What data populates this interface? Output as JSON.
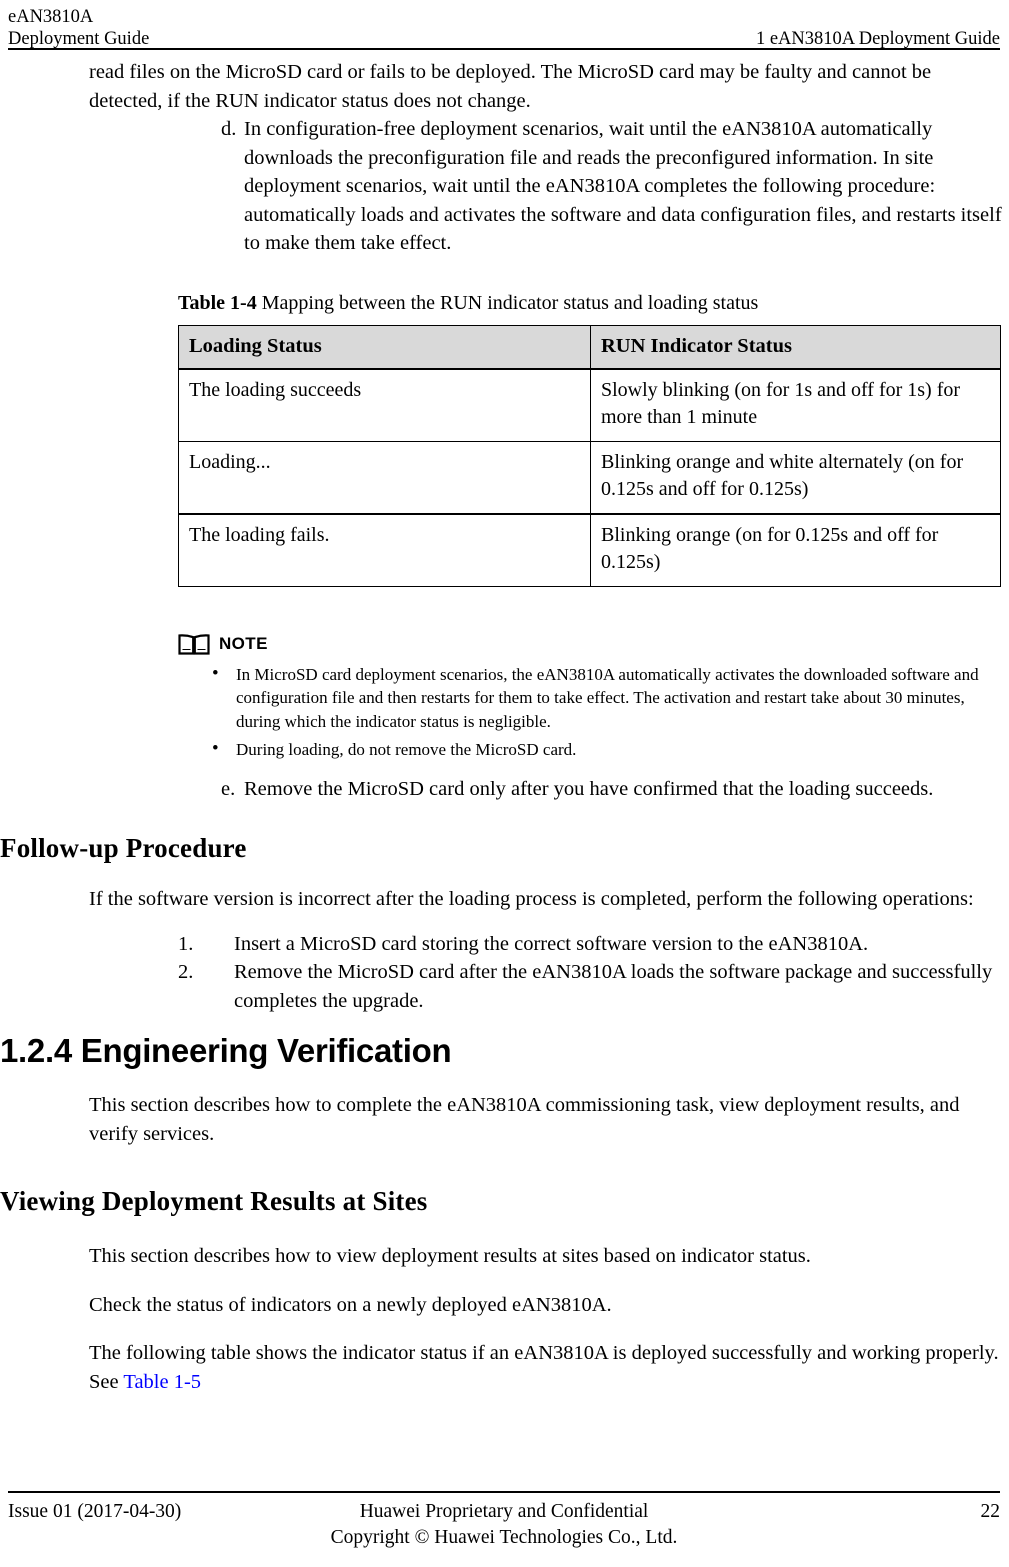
{
  "header": {
    "left_line1": "eAN3810A",
    "left_line2": "Deployment Guide",
    "right": "1 eAN3810A Deployment Guide"
  },
  "body": {
    "cont_paragraph": "read files on the MicroSD card or fails to be deployed. The MicroSD card may be faulty and cannot be detected, if the RUN indicator status does not change.",
    "item_d_marker": "d.",
    "item_d_text": "In configuration-free deployment scenarios, wait until the eAN3810A automatically downloads the preconfiguration file and reads the preconfigured information. In site deployment scenarios, wait until the eAN3810A completes the following procedure: automatically loads and activates the software and data configuration files, and restarts itself to make them take effect.",
    "item_e_marker": "e.",
    "item_e_text": "Remove the MicroSD card only after you have confirmed that the loading succeeds."
  },
  "table_1_4": {
    "caption_label": "Table 1-4",
    "caption_text": "Mapping between the RUN indicator status and loading status",
    "headers": [
      "Loading Status",
      "RUN Indicator Status"
    ],
    "rows": [
      [
        "The loading succeeds",
        "Slowly blinking (on for 1s and off for 1s) for more than 1 minute"
      ],
      [
        "Loading...",
        "Blinking orange and white alternately (on for 0.125s and off for 0.125s)"
      ],
      [
        "The loading fails.",
        "Blinking orange (on for 0.125s and off for 0.125s)"
      ]
    ]
  },
  "note": {
    "icon": "open-book-icon",
    "label": "NOTE",
    "items": [
      "In MicroSD card deployment scenarios, the eAN3810A automatically activates the downloaded software and configuration file and then restarts for them to take effect. The activation and restart take about 30 minutes, during which the indicator status is negligible.",
      "During loading, do not remove the MicroSD card."
    ]
  },
  "followup": {
    "heading": "Follow-up Procedure",
    "intro": "If the software version is incorrect after the loading process is completed, perform the following operations:",
    "steps": [
      {
        "marker": "1.",
        "text": "Insert a MicroSD card storing the correct software version to the eAN3810A."
      },
      {
        "marker": "2.",
        "text": "Remove the MicroSD card after the eAN3810A loads the software package and successfully completes the upgrade."
      }
    ]
  },
  "section_124": {
    "heading": "1.2.4 Engineering Verification",
    "paragraph": "This section describes how to complete the eAN3810A commissioning task, view deployment results, and verify services."
  },
  "viewing_section": {
    "heading": "Viewing Deployment Results at Sites",
    "p1": "This section describes how to view deployment results at sites based on indicator status.",
    "p2": "Check the status of indicators on a newly deployed eAN3810A.",
    "p3_before": "The following table shows the indicator status if an eAN3810A is deployed successfully and working properly. See ",
    "p3_link": "Table 1-5"
  },
  "footer": {
    "issue": "Issue 01 (2017-04-30)",
    "center_line1": "Huawei Proprietary and Confidential",
    "center_line2": "Copyright © Huawei Technologies Co., Ltd.",
    "page_number": "22"
  },
  "colors": {
    "link": "#0000ff",
    "table_header_bg": "#d9d9d9",
    "rule": "#000000"
  }
}
